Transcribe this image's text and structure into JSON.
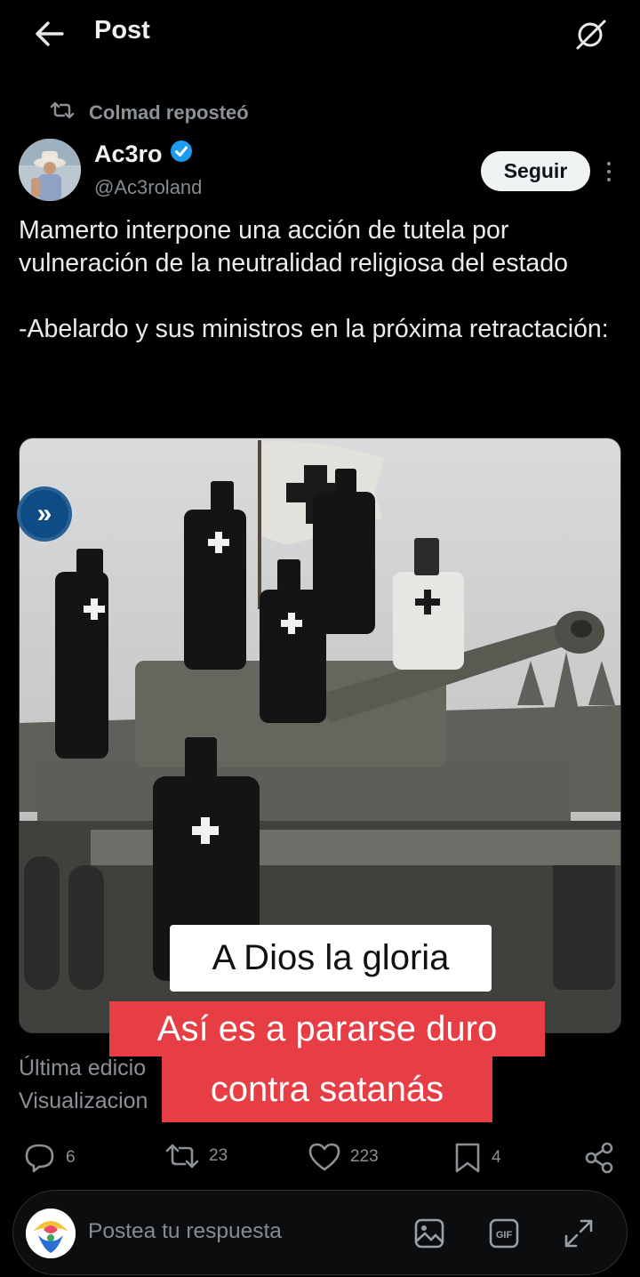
{
  "header": {
    "title": "Post"
  },
  "repost": {
    "label": "Colmad reposteó"
  },
  "author": {
    "name": "Ac3ro",
    "handle": "@Ac3roland",
    "verified": true
  },
  "follow_label": "Seguir",
  "post": {
    "text": "Mamerto interpone una acción de tutela por vulneración de la neutralidad religiosa del estado\n\n-Abelardo y sus ministros en la próxima retractación:"
  },
  "meta": {
    "edited": "Última edicio",
    "views": "Visualizacion"
  },
  "overlay_captions": {
    "white": "A Dios la gloria",
    "red_line1": "Así es a pararse duro",
    "red_line2": "contra satanás"
  },
  "actions": {
    "replies": "6",
    "reposts": "23",
    "likes": "223",
    "bookmarks": "4"
  },
  "reply_bar": {
    "placeholder": "Postea tu respuesta"
  },
  "colors": {
    "background": "#000000",
    "accent": "#1d9bf0",
    "caption_red": "#e63e44",
    "muted": "#8b9196"
  },
  "icons": [
    "back-arrow-icon",
    "grok-icon",
    "repost-icon",
    "verified-badge-icon",
    "more-icon",
    "expand-media-icon",
    "reply-icon",
    "repost-icon",
    "like-icon",
    "bookmark-icon",
    "share-icon",
    "image-icon",
    "gif-icon",
    "expand-icon"
  ]
}
